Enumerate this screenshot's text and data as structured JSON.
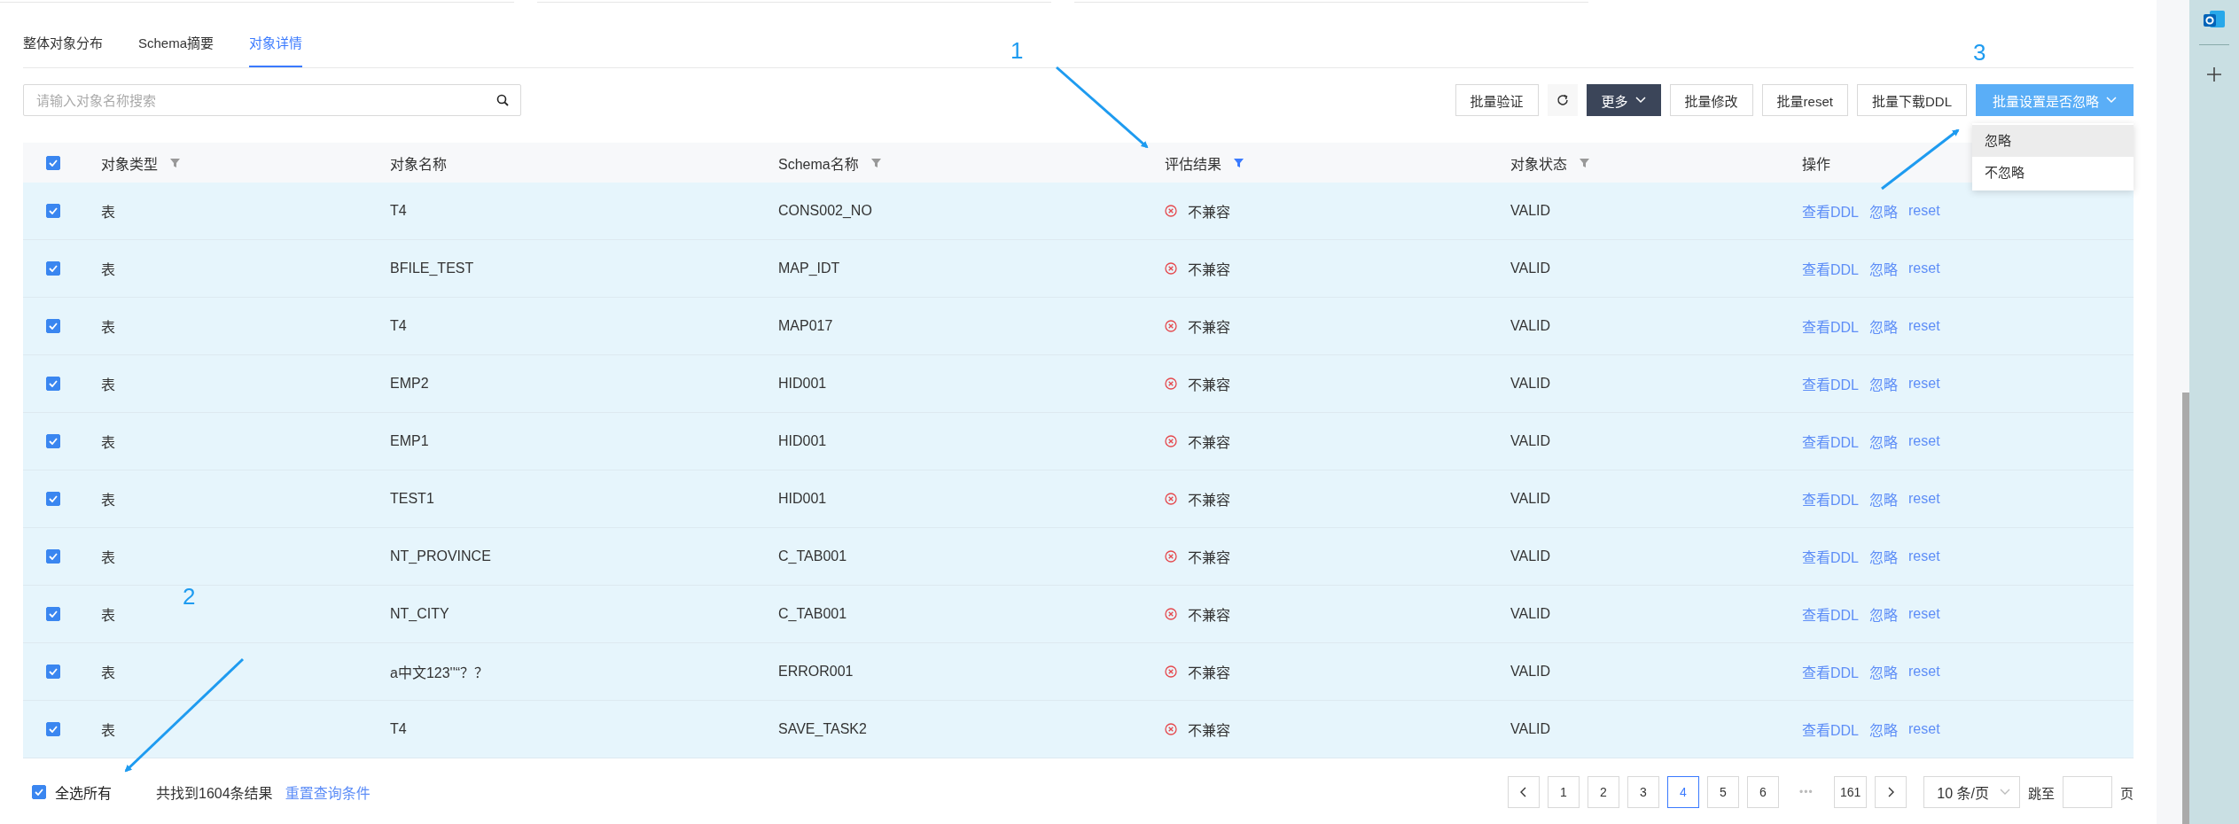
{
  "tabs": [
    {
      "label": "整体对象分布",
      "selected": false
    },
    {
      "label": "Schema摘要",
      "selected": false
    },
    {
      "label": "对象详情",
      "selected": true
    }
  ],
  "search": {
    "placeholder": "请输入对象名称搜索"
  },
  "toolbar": [
    {
      "label": "批量验证",
      "kind": "plain"
    },
    {
      "kind": "refresh"
    },
    {
      "label": "更多",
      "kind": "dark"
    },
    {
      "label": "批量修改",
      "kind": "plain"
    },
    {
      "label": "批量reset",
      "kind": "plain"
    },
    {
      "label": "批量下载DDL",
      "kind": "plain"
    },
    {
      "label": "批量设置是否忽略",
      "kind": "primary"
    }
  ],
  "dropdown": {
    "items": [
      {
        "label": "忽略",
        "hovered": true
      },
      {
        "label": "不忽略",
        "hovered": false
      }
    ]
  },
  "table": {
    "all_checked": true,
    "columns": [
      {
        "label": "对象类型",
        "kind": "filter",
        "filtered": false
      },
      {
        "label": "对象名称",
        "kind": "plain",
        "filtered": false
      },
      {
        "label": "Schema名称",
        "kind": "filter",
        "filtered": false
      },
      {
        "label": "评估结果",
        "kind": "filter",
        "filtered": true
      },
      {
        "label": "对象状态",
        "kind": "filter",
        "filtered": false
      },
      {
        "label": "操作",
        "kind": "plain",
        "filtered": false
      }
    ],
    "rows": [
      {
        "selected": true,
        "type": "表",
        "name": "T4",
        "schema": "CONS002_NO",
        "result": "不兼容",
        "status": "VALID",
        "actions": [
          "查看DDL",
          "忽略",
          "reset"
        ]
      },
      {
        "selected": true,
        "type": "表",
        "name": "BFILE_TEST",
        "schema": "MAP_IDT",
        "result": "不兼容",
        "status": "VALID",
        "actions": [
          "查看DDL",
          "忽略",
          "reset"
        ]
      },
      {
        "selected": true,
        "type": "表",
        "name": "T4",
        "schema": "MAP017",
        "result": "不兼容",
        "status": "VALID",
        "actions": [
          "查看DDL",
          "忽略",
          "reset"
        ]
      },
      {
        "selected": true,
        "type": "表",
        "name": "EMP2",
        "schema": "HID001",
        "result": "不兼容",
        "status": "VALID",
        "actions": [
          "查看DDL",
          "忽略",
          "reset"
        ]
      },
      {
        "selected": true,
        "type": "表",
        "name": "EMP1",
        "schema": "HID001",
        "result": "不兼容",
        "status": "VALID",
        "actions": [
          "查看DDL",
          "忽略",
          "reset"
        ]
      },
      {
        "selected": true,
        "type": "表",
        "name": "TEST1",
        "schema": "HID001",
        "result": "不兼容",
        "status": "VALID",
        "actions": [
          "查看DDL",
          "忽略",
          "reset"
        ]
      },
      {
        "selected": true,
        "type": "表",
        "name": "NT_PROVINCE",
        "schema": "C_TAB001",
        "result": "不兼容",
        "status": "VALID",
        "actions": [
          "查看DDL",
          "忽略",
          "reset"
        ]
      },
      {
        "selected": true,
        "type": "表",
        "name": "NT_CITY",
        "schema": "C_TAB001",
        "result": "不兼容",
        "status": "VALID",
        "actions": [
          "查看DDL",
          "忽略",
          "reset"
        ]
      },
      {
        "selected": true,
        "type": "表",
        "name": "a中文123''“？？",
        "schema": "ERROR001",
        "result": "不兼容",
        "status": "VALID",
        "actions": [
          "查看DDL",
          "忽略",
          "reset"
        ]
      },
      {
        "selected": true,
        "type": "表",
        "name": "T4",
        "schema": "SAVE_TASK2",
        "result": "不兼容",
        "status": "VALID",
        "actions": [
          "查看DDL",
          "忽略",
          "reset"
        ]
      }
    ]
  },
  "footer": {
    "select_all": {
      "label": "全选所有",
      "checked": true
    },
    "total": "共找到1604条结果",
    "reset_link": "重置查询条件"
  },
  "pagination": {
    "pages": [
      {
        "kind": "page",
        "label": "1",
        "selected": false
      },
      {
        "kind": "page",
        "label": "2",
        "selected": false
      },
      {
        "kind": "page",
        "label": "3",
        "selected": false
      },
      {
        "kind": "page",
        "label": "4",
        "selected": true
      },
      {
        "kind": "page",
        "label": "5",
        "selected": false
      },
      {
        "kind": "page",
        "label": "6",
        "selected": false
      },
      {
        "kind": "ellipsis",
        "label": "•••",
        "selected": false
      },
      {
        "kind": "page",
        "label": "161",
        "selected": false
      }
    ],
    "page_size": "10 条/页",
    "jump_label": "跳至",
    "jump_unit": "页"
  },
  "annotations": [
    {
      "label": "1"
    },
    {
      "label": "2"
    },
    {
      "label": "3"
    }
  ]
}
